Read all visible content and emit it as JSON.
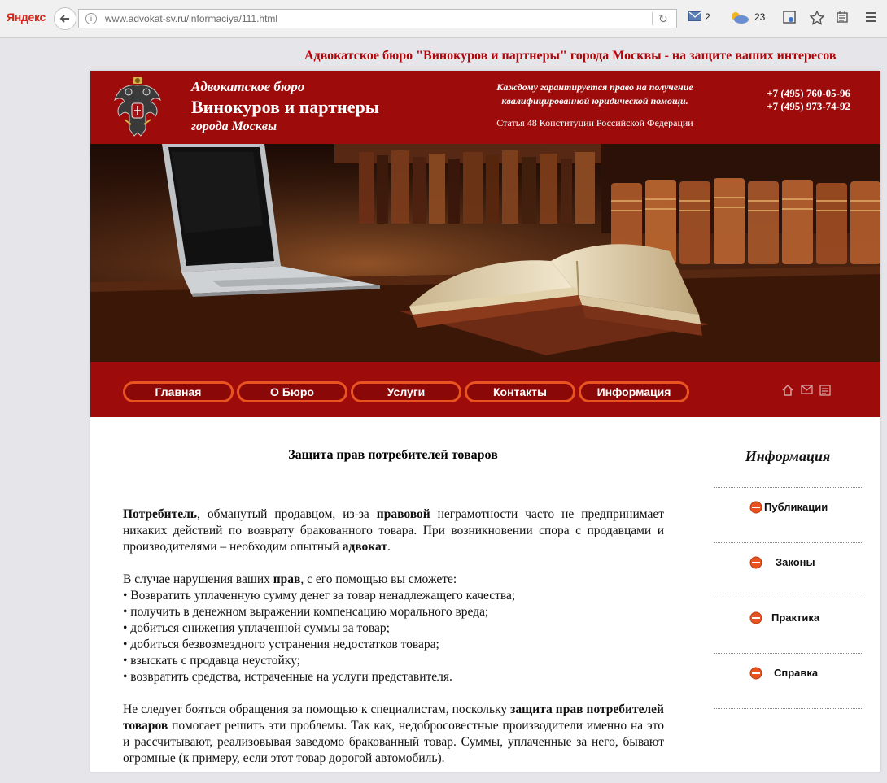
{
  "browser": {
    "logo": "Яндекс",
    "url": "www.advokat-sv.ru/informaciya/111.html",
    "mail_count": "2",
    "weather_temp": "23"
  },
  "tagline": "Адвокатское бюро \"Винокуров и партнеры\" города Москвы - на защите ваших интересов",
  "header": {
    "brand_line1": "Адвокатское бюро",
    "brand_line2": "Винокуров и партнеры",
    "brand_line3": "города Москвы",
    "quote_line1": "Каждому гарантируется право на получение",
    "quote_line2": "квалифицированной юридической помощи.",
    "quote_source": "Статья 48 Конституции Российской Федерации",
    "phone1": "+7 (495) 760-05-96",
    "phone2": "+7 (495) 973-74-92"
  },
  "menu": [
    "Главная",
    "О Бюро",
    "Услуги",
    "Контакты",
    "Информация"
  ],
  "article": {
    "title": "Защита прав потребителей товаров",
    "p1": [
      {
        "t": "Потребитель",
        "b": true
      },
      {
        "t": ", обманутый продавцом, из-за ",
        "b": false
      },
      {
        "t": "правовой",
        "b": true
      },
      {
        "t": " неграмотности часто не предпринимает никаких действий по возврату бракованного товара. При возникновении спора с продавцами и производителями – необходим опытный ",
        "b": false
      },
      {
        "t": "адвокат",
        "b": true
      },
      {
        "t": ".",
        "b": false
      }
    ],
    "list_intro": [
      {
        "t": "В случае нарушения ваших ",
        "b": false
      },
      {
        "t": "прав",
        "b": true
      },
      {
        "t": ", с его помощью вы сможете:",
        "b": false
      }
    ],
    "list": [
      "• Возвратить уплаченную сумму денег за товар ненадлежащего качества;",
      "• получить в денежном выражении компенсацию морального вреда;",
      "• добиться снижения уплаченной суммы за товар;",
      "• добиться безвозмездного устранения недостатков товара;",
      "• взыскать с продавца неустойку;",
      "• возвратить средства, истраченные на услуги представителя."
    ],
    "p3": [
      {
        "t": "Не следует бояться обращения за помощью к специалистам, поскольку ",
        "b": false
      },
      {
        "t": "защита прав потребителей товаров",
        "b": true
      },
      {
        "t": " помогает решить эти проблемы. Так как, недобросовестные производители именно на это и рассчитывают, реализовывая заведомо бракованный товар. Суммы, уплаченные за него, бывают огромные (к примеру, если этот товар дорогой автомобиль).",
        "b": false
      }
    ]
  },
  "sidebar": {
    "title": "Информация",
    "items": [
      "Публикации",
      "Законы",
      "Практика",
      "Справка"
    ]
  },
  "colors": {
    "brand_red": "#9d0b0b",
    "tagline_red": "#b2050a",
    "menu_border": "#e9531f"
  }
}
